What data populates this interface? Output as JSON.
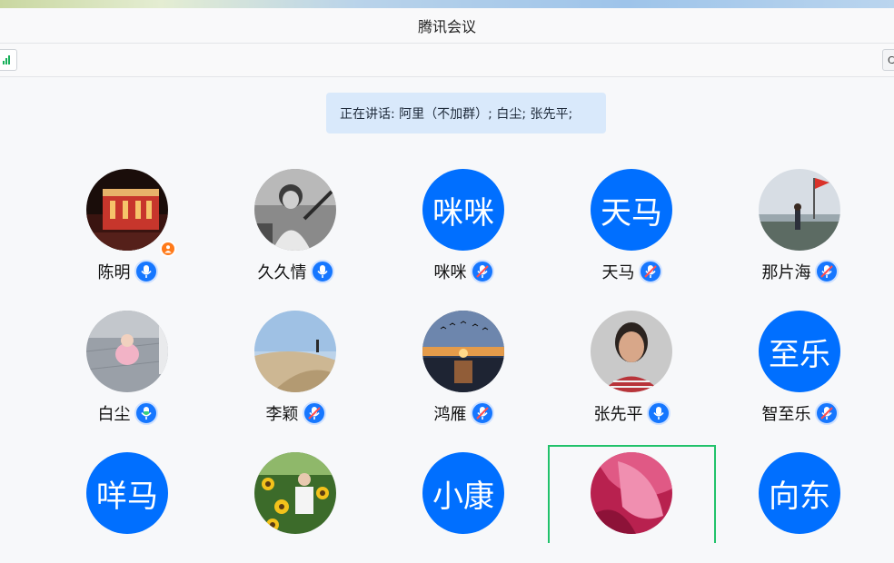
{
  "window": {
    "title": "腾讯会议"
  },
  "toolbar": {
    "right_button_glyph": "C"
  },
  "speaking": {
    "text": "正在讲话: 阿里（不加群）; 白尘; 张先平;"
  },
  "colors": {
    "accent": "#006fff",
    "mic_blue": "#1677ff",
    "active_border": "#22c26b",
    "speaking_bg": "#d9e9fb",
    "host_badge": "#ff7a1a"
  },
  "participants": [
    {
      "name": "陈明",
      "avatar_type": "photo",
      "avatar_desc": "red-gate-night-photo",
      "mic": "active",
      "host": true
    },
    {
      "name": "久久情",
      "avatar_type": "photo",
      "avatar_desc": "bw-girl-photo",
      "mic": "active"
    },
    {
      "name": "咪咪",
      "avatar_type": "text",
      "avatar_text": "咪咪",
      "mic": "muted"
    },
    {
      "name": "天马",
      "avatar_type": "text",
      "avatar_text": "天马",
      "mic": "muted"
    },
    {
      "name": "那片海",
      "avatar_type": "photo",
      "avatar_desc": "seaside-flag-photo",
      "mic": "muted"
    },
    {
      "name": "白尘",
      "avatar_type": "photo",
      "avatar_desc": "child-pink-dress-photo",
      "mic": "speaking"
    },
    {
      "name": "李颖",
      "avatar_type": "photo",
      "avatar_desc": "desert-dunes-photo",
      "mic": "muted"
    },
    {
      "name": "鸿雁",
      "avatar_type": "photo",
      "avatar_desc": "sunset-geese-photo",
      "mic": "muted"
    },
    {
      "name": "张先平",
      "avatar_type": "photo",
      "avatar_desc": "woman-portrait-photo",
      "mic": "active"
    },
    {
      "name": "智至乐",
      "avatar_type": "text",
      "avatar_text": "至乐",
      "mic": "muted"
    },
    {
      "name": "",
      "avatar_type": "text",
      "avatar_text": "咩马"
    },
    {
      "name": "",
      "avatar_type": "photo",
      "avatar_desc": "sunflowers-man-photo"
    },
    {
      "name": "",
      "avatar_type": "text",
      "avatar_text": "小康"
    },
    {
      "name": "",
      "avatar_type": "photo",
      "avatar_desc": "pink-flower-photo",
      "active": true
    },
    {
      "name": "",
      "avatar_type": "text",
      "avatar_text": "向东"
    }
  ]
}
